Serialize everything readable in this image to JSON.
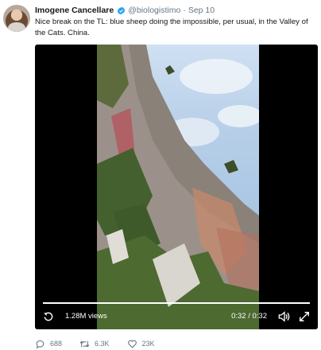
{
  "tweet": {
    "display_name": "Imogene Cancellare",
    "handle": "@biologistimo",
    "separator": "·",
    "date": "Sep 10",
    "text": "Nice break on the TL: blue sheep doing the impossible, per usual, in the Valley of the Cats. China.",
    "verified_icon": "verified-badge-icon"
  },
  "video": {
    "views": "1.28M views",
    "time": "0:32 / 0:32",
    "progress": 1.0,
    "icons": [
      "replay-icon",
      "volume-icon",
      "fullscreen-icon"
    ]
  },
  "actions": {
    "replies": "688",
    "retweets": "6.3K",
    "likes": "23K",
    "icons": [
      "reply-icon",
      "retweet-icon",
      "like-icon"
    ]
  },
  "colors": {
    "accent": "#1da1f2",
    "secondary_text": "#657786"
  }
}
